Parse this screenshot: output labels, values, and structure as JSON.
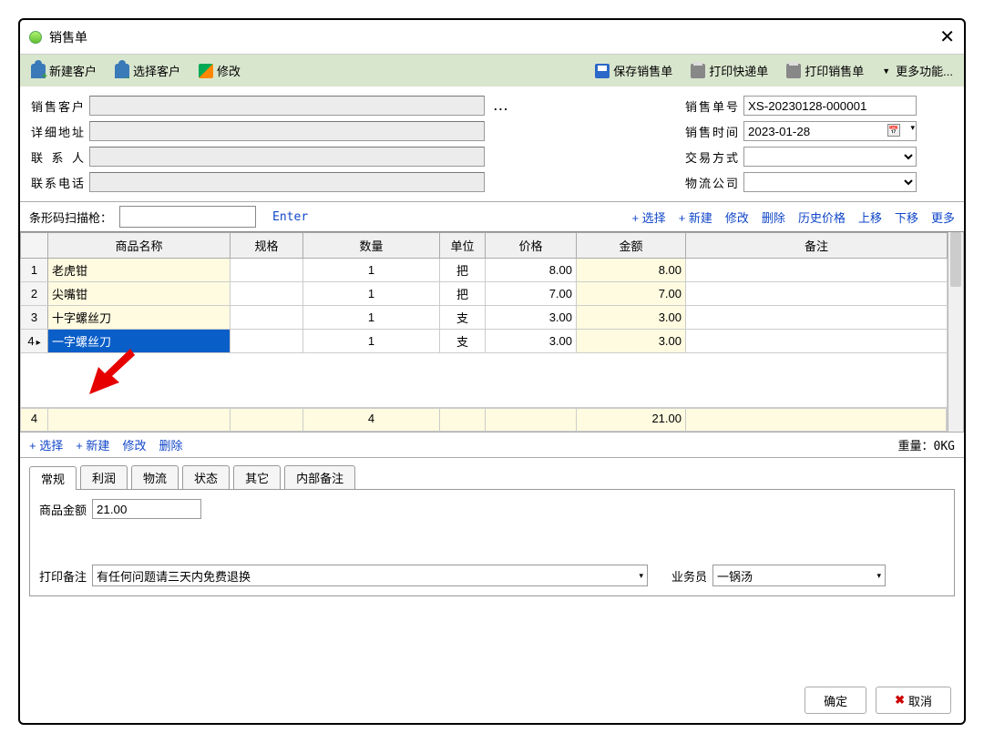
{
  "window": {
    "title": "销售单"
  },
  "toolbar": {
    "new_customer": "新建客户",
    "select_customer": "选择客户",
    "modify": "修改",
    "save_order": "保存销售单",
    "print_express": "打印快递单",
    "print_order": "打印销售单",
    "more": "更多功能..."
  },
  "form": {
    "labels": {
      "customer": "销售客户",
      "address": "详细地址",
      "contact": "联 系 人",
      "phone": "联系电话",
      "order_no": "销售单号",
      "sale_time": "销售时间",
      "trade_type": "交易方式",
      "logistics": "物流公司"
    },
    "values": {
      "customer": "",
      "address": "",
      "contact": "",
      "phone": "",
      "order_no": "XS-20230128-000001",
      "sale_time": "2023-01-28",
      "trade_type": "",
      "logistics": ""
    }
  },
  "scanbar": {
    "label": "条形码扫描枪：",
    "value": "",
    "enter": "Enter",
    "actions": {
      "select": "+ 选择",
      "new": "+ 新建",
      "modify": "修改",
      "delete": "删除",
      "history": "历史价格",
      "up": "上移",
      "down": "下移",
      "more": "更多"
    }
  },
  "grid": {
    "headers": {
      "name": "商品名称",
      "spec": "规格",
      "qty": "数量",
      "unit": "单位",
      "price": "价格",
      "amount": "金额",
      "remark": "备注"
    },
    "rows": [
      {
        "name": "老虎钳",
        "spec": "",
        "qty": "1",
        "unit": "把",
        "price": "8.00",
        "amount": "8.00",
        "remark": ""
      },
      {
        "name": "尖嘴钳",
        "spec": "",
        "qty": "1",
        "unit": "把",
        "price": "7.00",
        "amount": "7.00",
        "remark": ""
      },
      {
        "name": "十字螺丝刀",
        "spec": "",
        "qty": "1",
        "unit": "支",
        "price": "3.00",
        "amount": "3.00",
        "remark": ""
      },
      {
        "name": "一字螺丝刀",
        "spec": "",
        "qty": "1",
        "unit": "支",
        "price": "3.00",
        "amount": "3.00",
        "remark": ""
      }
    ],
    "totals": {
      "count": "4",
      "qty": "4",
      "amount": "21.00"
    }
  },
  "bottombar": {
    "select": "+ 选择",
    "new": "+ 新建",
    "modify": "修改",
    "delete": "删除",
    "weight_label": "重量：",
    "weight_value": "0KG"
  },
  "tabs": {
    "general": "常规",
    "profit": "利润",
    "logistics": "物流",
    "status": "状态",
    "other": "其它",
    "internal_remark": "内部备注"
  },
  "general_tab": {
    "amount_label": "商品金额",
    "amount_value": "21.00",
    "print_remark_label": "打印备注",
    "print_remark_value": "有任何问题请三天内免费退换",
    "salesperson_label": "业务员",
    "salesperson_value": "一锅汤"
  },
  "footer": {
    "ok": "确定",
    "cancel": "取消"
  }
}
